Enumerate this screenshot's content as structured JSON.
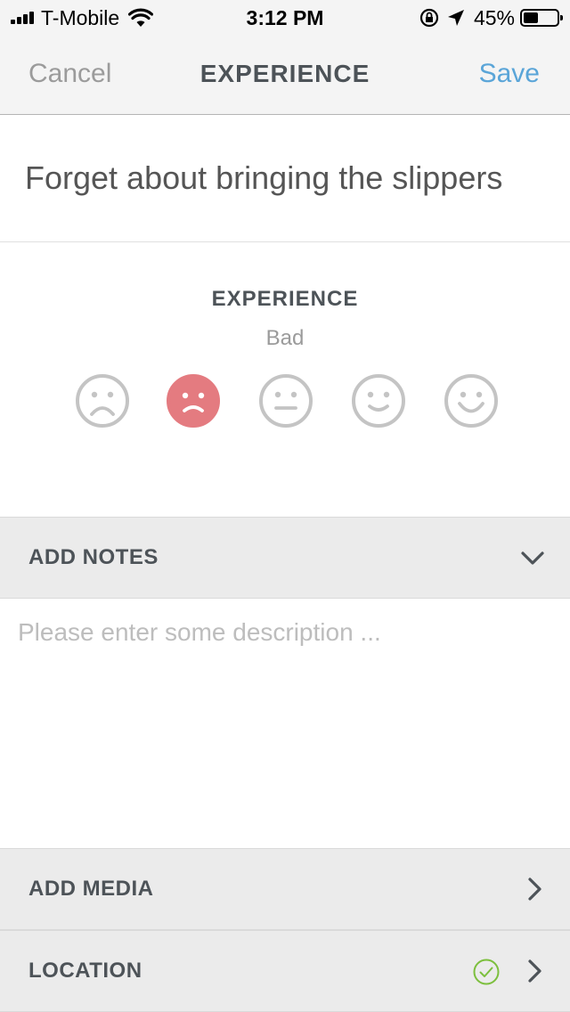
{
  "status_bar": {
    "carrier": "T-Mobile",
    "time": "3:12 PM",
    "battery": "45%",
    "battery_level": 0.45
  },
  "nav": {
    "cancel": "Cancel",
    "title": "EXPERIENCE",
    "save": "Save"
  },
  "entry": {
    "title": "Forget about bringing the slippers"
  },
  "experience": {
    "heading": "EXPERIENCE",
    "value": "Bad",
    "selected_index": 1,
    "accent_color": "#e47b80",
    "faces": [
      "very-sad-face-icon",
      "sad-face-icon",
      "neutral-face-icon",
      "smile-face-icon",
      "big-smile-face-icon"
    ]
  },
  "notes": {
    "header": "ADD NOTES",
    "placeholder": "Please enter some description ..."
  },
  "media": {
    "header": "ADD MEDIA"
  },
  "location": {
    "header": "LOCATION",
    "status_color": "#7cbf3d"
  }
}
